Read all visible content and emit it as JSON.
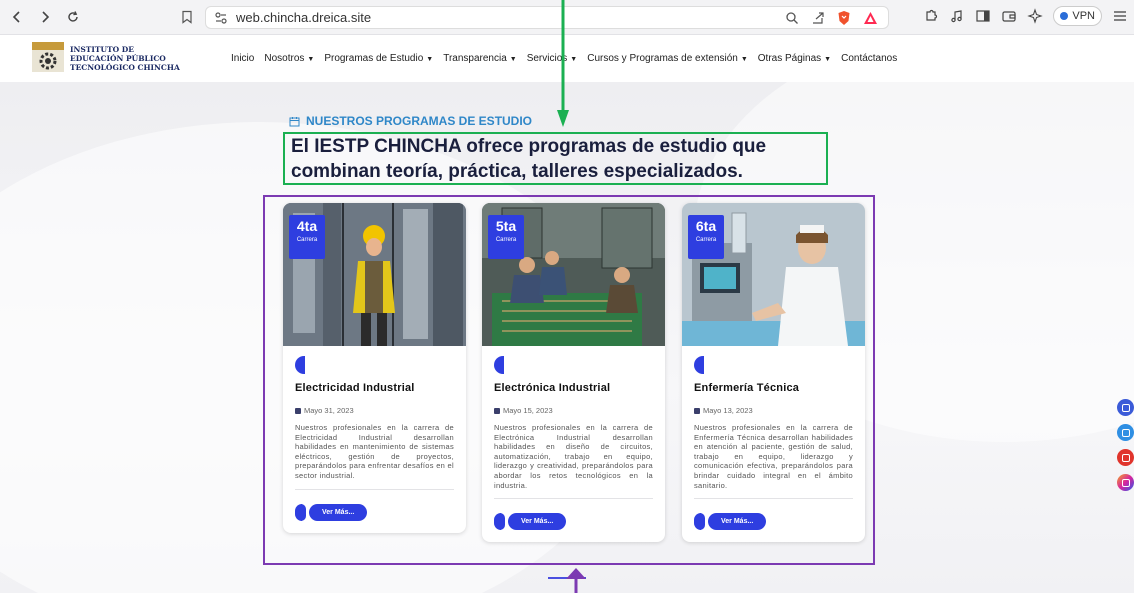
{
  "browser": {
    "url": "web.chincha.dreica.site",
    "vpn_label": "VPN"
  },
  "site": {
    "brand_lines": [
      "INSTITUTO DE",
      "EDUCACIÓN PÚBLICO",
      "TECNOLÓGICO CHINCHA"
    ],
    "menu": [
      {
        "label": "Inicio",
        "dropdown": false
      },
      {
        "label": "Nosotros",
        "dropdown": true
      },
      {
        "label": "Programas de Estudio",
        "dropdown": true
      },
      {
        "label": "Transparencia",
        "dropdown": true
      },
      {
        "label": "Servicios",
        "dropdown": true
      },
      {
        "label": "Cursos y Programas de extensión",
        "dropdown": true
      },
      {
        "label": "Otras Páginas",
        "dropdown": true
      },
      {
        "label": "Contáctanos",
        "dropdown": false
      }
    ]
  },
  "section": {
    "kicker": "NUESTROS PROGRAMAS DE ESTUDIO",
    "headline_line1": "El IESTP CHINCHA ofrece programas de estudio que",
    "headline_line2": "combinan teoría, práctica, talleres especializados."
  },
  "cards": [
    {
      "badge_number": "4ta",
      "badge_label": "Carrera",
      "title": "Electricidad Industrial",
      "date": "Mayo 31, 2023",
      "description": "Nuestros profesionales en la carrera de Electricidad Industrial desarrollan habilidades en mantenimiento de sistemas eléctricos, gestión de proyectos, preparándolos para enfrentar desafíos en el sector industrial.",
      "button": "Ver Más..."
    },
    {
      "badge_number": "5ta",
      "badge_label": "Carrera",
      "title": "Electrónica Industrial",
      "date": "Mayo 15, 2023",
      "description": "Nuestros profesionales en la carrera de Electrónica Industrial desarrollan habilidades en diseño de circuitos, automatización, trabajo en equipo, liderazgo y creatividad, preparándolos para abordar los retos tecnológicos en la industria.",
      "button": "Ver Más..."
    },
    {
      "badge_number": "6ta",
      "badge_label": "Carrera",
      "title": "Enfermería Técnica",
      "date": "Mayo 13, 2023",
      "description": "Nuestros profesionales en la carrera de Enfermería Técnica desarrollan habilidades en atención al paciente, gestión de salud, trabajo en equipo, liderazgo y comunicación efectiva, preparándolos para brindar cuidado integral en el ámbito sanitario.",
      "button": "Ver Más..."
    }
  ],
  "colors": {
    "accent": "#2e3ee0",
    "kicker": "#2f87c8",
    "annotation_green": "#1bb052",
    "annotation_purple": "#7c3ab2"
  },
  "icons": {
    "social": [
      "facebook-icon",
      "twitter-icon",
      "youtube-icon",
      "instagram-icon"
    ]
  }
}
